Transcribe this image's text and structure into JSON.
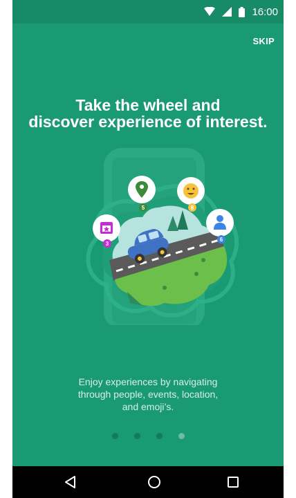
{
  "status_bar": {
    "time": "16:00",
    "icons": [
      "wifi-icon",
      "signal-icon",
      "battery-icon"
    ]
  },
  "top": {
    "skip_label": "SKIP"
  },
  "headline": {
    "line1": "Take the wheel and",
    "line2": "discover experience of interest."
  },
  "illustration": {
    "badges": [
      {
        "icon": "calendar-star-icon",
        "count": "3",
        "color": "#c62bd6"
      },
      {
        "icon": "location-pin-icon",
        "count": "5",
        "color": "#3c8a3c"
      },
      {
        "icon": "emoji-smile-icon",
        "count": "8",
        "color": "#f6c23b"
      },
      {
        "icon": "person-icon",
        "count": "6",
        "color": "#3c84e6"
      }
    ]
  },
  "description": {
    "line1": "Enjoy experiences by navigating",
    "line2": "through people, events, location,",
    "line3": "and emoji’s."
  },
  "pagination": {
    "total_pages": 4,
    "active_page": 4
  },
  "nav_bar": {
    "buttons": [
      "back-icon",
      "home-icon",
      "recents-icon"
    ]
  },
  "colors": {
    "background": "#1a9a72",
    "status_bar": "#178a66",
    "nav_bar": "#000000"
  }
}
